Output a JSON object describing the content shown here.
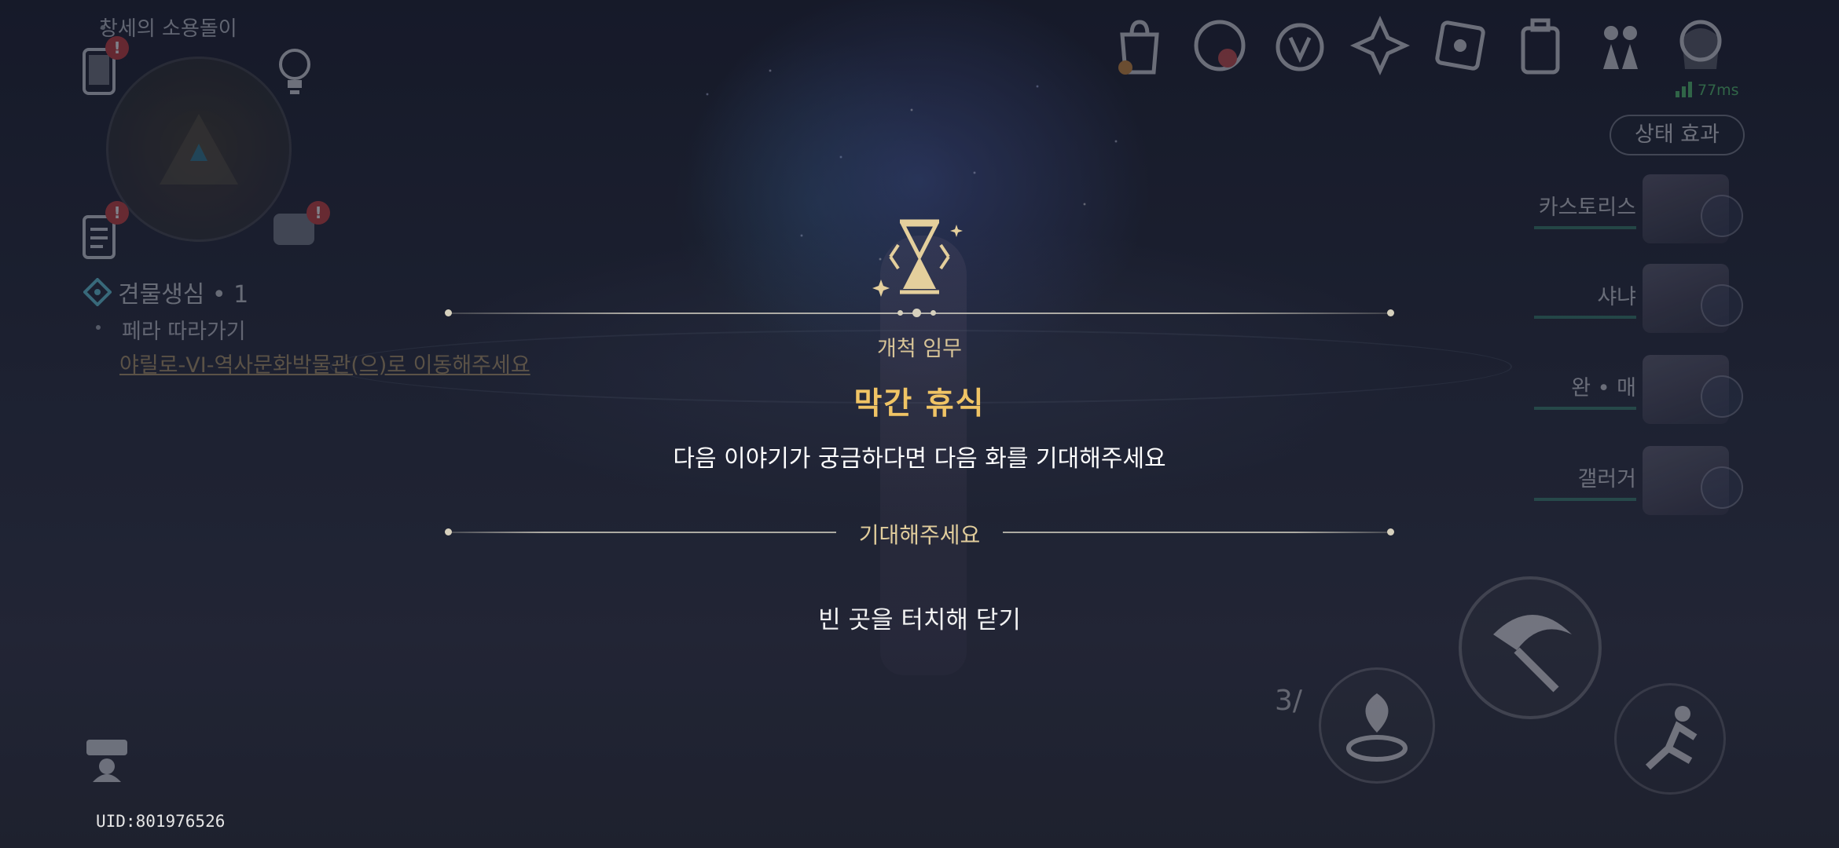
{
  "hud": {
    "quest_top": "창세의 소용돌이",
    "mission_title": "견물생심 • 1",
    "mission_sub": "페라 따라가기",
    "mission_link": "야릴로-VI-역사문화박물관(으)로 이동해주세요",
    "uid": "UID:801976526",
    "ping": "77ms",
    "status_effect": "상태 효과",
    "alert_mark": "!",
    "skill_points": "3",
    "skill_points_suffix": "/"
  },
  "party": [
    {
      "name": "카스토리스",
      "icon": "butterfly-icon"
    },
    {
      "name": "샤냐",
      "icon": "element-icon"
    },
    {
      "name": "완 • 매",
      "icon": "element-icon"
    },
    {
      "name": "갤러거",
      "icon": "fire-icon"
    }
  ],
  "top_icons": [
    "shop-bag-icon",
    "event-icon",
    "warp-icon",
    "star-rail-icon",
    "map-icon",
    "inventory-icon",
    "party-icon",
    "character-icon"
  ],
  "popup": {
    "category": "개척 임무",
    "title": "막간 휴식",
    "description": "다음 이야기가 궁금하다면 다음 화를 기대해주세요",
    "subtitle": "기대해주세요",
    "close_hint": "빈 곳을 터치해 닫기"
  },
  "colors": {
    "gold": "#f0c465",
    "alert": "#c83a3a",
    "ping": "#4fbf6a"
  }
}
